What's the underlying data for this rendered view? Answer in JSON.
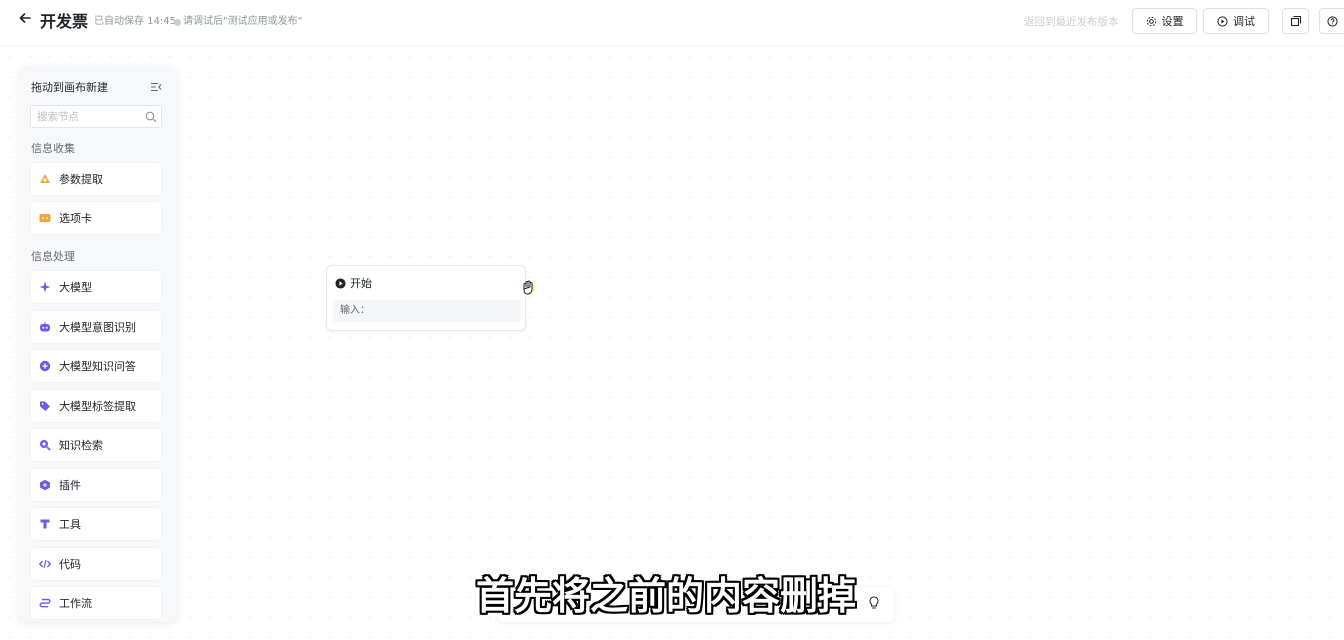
{
  "header": {
    "back_icon": "arrow-left-icon",
    "title": "开发票",
    "autosave": "已自动保存 14:45",
    "hint": "请调试后\"测试应用或发布\"",
    "revert_link": "返回到最近发布版本",
    "settings_label": "设置",
    "debug_label": "调试",
    "copy_icon": "copy-icon",
    "help_icon": "help-icon"
  },
  "panel": {
    "title": "拖动到画布新建",
    "search_placeholder": "搜索节点",
    "groups": [
      {
        "label": "信息收集",
        "items": [
          {
            "label": "参数提取",
            "icon": "param-extract-icon",
            "color": "#f5a33a"
          },
          {
            "label": "选项卡",
            "icon": "tab-card-icon",
            "color": "#f5a33a"
          }
        ]
      },
      {
        "label": "信息处理",
        "items": [
          {
            "label": "大模型",
            "icon": "sparkle-icon",
            "color": "#6e5ce6"
          },
          {
            "label": "大模型意图识别",
            "icon": "robot-icon",
            "color": "#6e5ce6"
          },
          {
            "label": "大模型知识问答",
            "icon": "plus-circle-icon",
            "color": "#6e5ce6"
          },
          {
            "label": "大模型标签提取",
            "icon": "tag-icon",
            "color": "#6e5ce6"
          },
          {
            "label": "知识检索",
            "icon": "search-knowledge-icon",
            "color": "#6e5ce6"
          },
          {
            "label": "插件",
            "icon": "plugin-icon",
            "color": "#6e5ce6"
          },
          {
            "label": "工具",
            "icon": "tool-icon",
            "color": "#6e5ce6"
          },
          {
            "label": "代码",
            "icon": "code-icon",
            "color": "#6e5ce6"
          },
          {
            "label": "工作流",
            "icon": "workflow-icon",
            "color": "#6e5ce6"
          }
        ]
      }
    ]
  },
  "start_node": {
    "title": "开始",
    "input_label": "输入："
  },
  "subtitle": "首先将之前的内容删掉",
  "colors": {
    "accent": "#6e5ce6",
    "orange": "#f5a33a"
  }
}
